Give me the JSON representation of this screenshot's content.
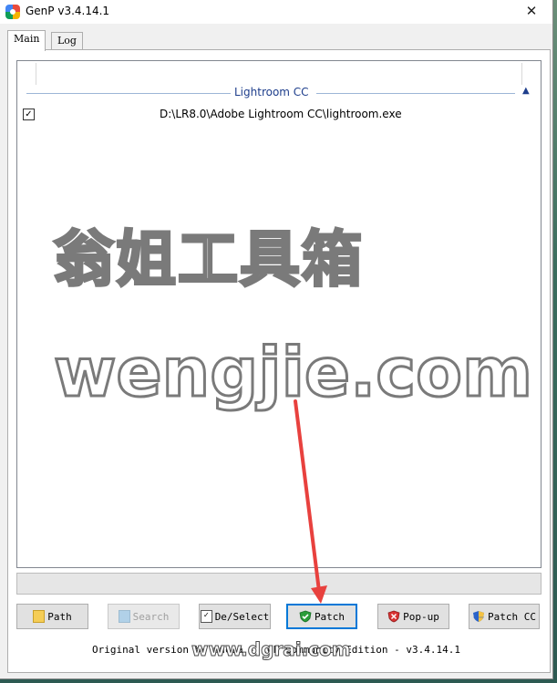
{
  "window": {
    "title": "GenP v3.4.14.1",
    "close_glyph": "✕"
  },
  "tabs": [
    {
      "label": "Main",
      "active": true
    },
    {
      "label": "Log",
      "active": false
    }
  ],
  "group": {
    "title": "Lightroom CC",
    "collapse_glyph": "▲"
  },
  "items": [
    {
      "checked": true,
      "check_glyph": "☑",
      "path": "D:\\LR8.0\\Adobe Lightroom CC\\lightroom.exe"
    }
  ],
  "watermark": {
    "cn": "翁姐工具箱",
    "en": "wengjie.com"
  },
  "progress": {
    "value": 0
  },
  "buttons": {
    "path": {
      "label": "Path",
      "icon": "folder-icon"
    },
    "search": {
      "label": "Search",
      "icon": "search-icon",
      "disabled": true
    },
    "deselect": {
      "label": "De/Select",
      "icon": "checkbox-icon"
    },
    "patch": {
      "label": "Patch",
      "icon": "green-shield-check-icon"
    },
    "popup": {
      "label": "Pop-up",
      "icon": "red-shield-x-icon"
    },
    "patch_cc": {
      "label": "Patch CC",
      "icon": "uac-shield-icon"
    }
  },
  "footer": {
    "text": "Original version by uncia - CGP Community Edition - v3.4.14.1"
  },
  "overlay": {
    "url": "www.dgrai.com"
  },
  "colors": {
    "accent": "#0078d7",
    "group_title": "#1e3e8c",
    "arrow": "#e8413e"
  }
}
